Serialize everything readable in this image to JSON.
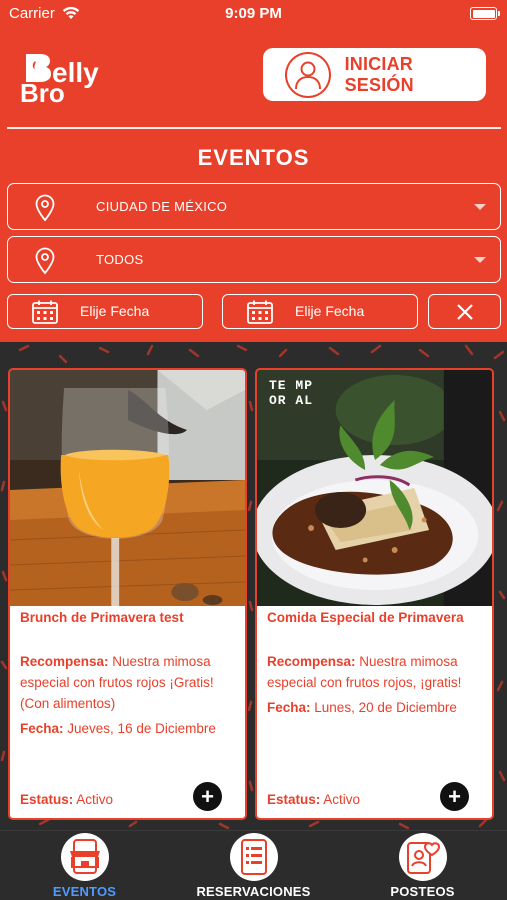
{
  "status_bar": {
    "carrier": "Carrier",
    "time": "9:09 PM"
  },
  "header": {
    "logo_alt": "Belly Bro",
    "login_label": "INICIAR SESIÓN",
    "page_title": "EVENTOS"
  },
  "filters": {
    "city": "CIUDAD DE MÉXICO",
    "category": "TODOS",
    "date_from": "Elije Fecha",
    "date_to": "Elije Fecha"
  },
  "events": [
    {
      "title": "Brunch de Primavera test",
      "reward_label": "Recompensa:",
      "reward": "Nuestra mimosa especial con frutos rojos ¡Gratis! (Con alimentos)",
      "date_label": "Fecha:",
      "date": "Jueves, 16 de Diciembre",
      "status_label": "Estatus:",
      "status": "Activo"
    },
    {
      "title": "Comida Especial de Primavera",
      "reward_label": "Recompensa:",
      "reward": "Nuestra mimosa especial con frutos rojos, ¡gratis!",
      "date_label": "Fecha:",
      "date": "Lunes, 20 de Diciembre",
      "status_label": "Estatus:",
      "status": "Activo",
      "photo_text": "TE MP OR AL"
    }
  ],
  "tabs": [
    {
      "label": "EVENTOS",
      "icon": "store-icon",
      "active": true
    },
    {
      "label": "RESERVACIONES",
      "icon": "list-icon",
      "active": false
    },
    {
      "label": "POSTEOS",
      "icon": "heart-post-icon",
      "active": false
    }
  ],
  "colors": {
    "brand": "#e8402a",
    "dark": "#2c2c2c",
    "active_tab": "#4f9bff"
  }
}
